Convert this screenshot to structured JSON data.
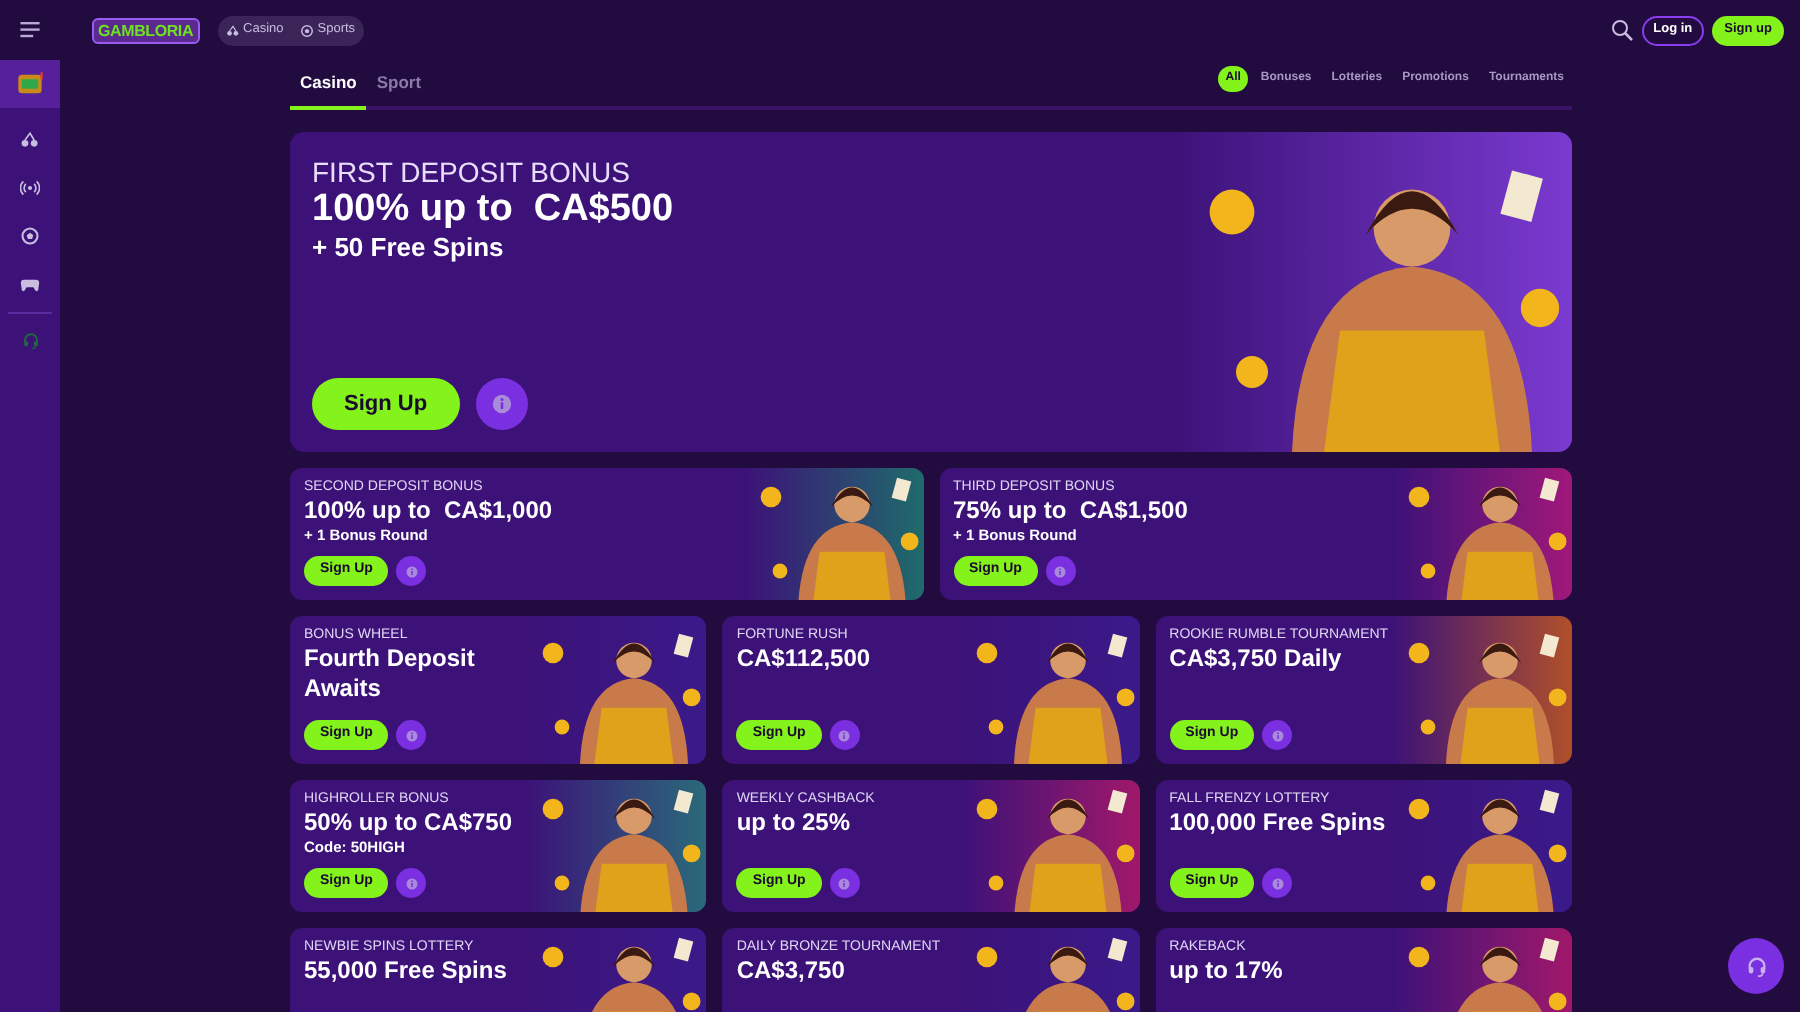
{
  "header": {
    "logo": "GAMBLORIA",
    "nav": [
      {
        "label": "Casino"
      },
      {
        "label": "Sports"
      }
    ],
    "login": "Log in",
    "signup": "Sign up"
  },
  "sidebar": {
    "items": [
      {
        "selected": true
      },
      {
        "selected": false
      },
      {
        "selected": false
      },
      {
        "selected": false
      },
      {
        "selected": false
      }
    ]
  },
  "tabs": [
    {
      "label": "Casino",
      "selected": true
    },
    {
      "label": "Sport",
      "selected": false
    }
  ],
  "filters": [
    {
      "label": "All",
      "selected": true
    },
    {
      "label": "Bonuses",
      "selected": false
    },
    {
      "label": "Lotteries",
      "selected": false
    },
    {
      "label": "Promotions",
      "selected": false
    },
    {
      "label": "Tournaments",
      "selected": false
    }
  ],
  "hero": {
    "label": "FIRST DEPOSIT BONUS",
    "title": "100% up to  CA$500",
    "subtitle": "+ 50 Free Spins",
    "button": "Sign Up",
    "kind": "picture"
  },
  "rows": [
    {
      "cards": [
        {
          "category": "SECOND DEPOSIT BONUS",
          "title": "100% up to  CA$1,000",
          "subtitle": "+ 1 Bonus Round",
          "button": "Sign Up"
        },
        {
          "category": "THIRD DEPOSIT BONUS",
          "title": "75% up to  CA$1,500",
          "subtitle": "+ 1 Bonus Round",
          "button": "Sign Up"
        }
      ]
    },
    {
      "cards": [
        {
          "category": "BONUS WHEEL",
          "title": "Fourth Deposit Awaits",
          "button": "Sign Up"
        },
        {
          "category": "FORTUNE RUSH",
          "title": "CA$112,500",
          "button": "Sign Up"
        },
        {
          "category": "ROOKIE RUMBLE TOURNAMENT",
          "title": "CA$3,750 Daily",
          "button": "Sign Up"
        }
      ]
    },
    {
      "cards": [
        {
          "category": "HIGHROLLER BONUS",
          "title": "50% up to CA$750",
          "subtitle": "Code: 50HIGH",
          "button": "Sign Up"
        },
        {
          "category": "WEEKLY CASHBACK",
          "title": "up to 25%",
          "button": "Sign Up"
        },
        {
          "category": "FALL FRENZY LOTTERY",
          "title": "100,000 Free Spins",
          "button": "Sign Up"
        }
      ]
    },
    {
      "cards": [
        {
          "category": "NEWBIE SPINS LOTTERY",
          "title": "55,000 Free Spins"
        },
        {
          "category": "DAILY BRONZE TOURNAMENT",
          "title": "CA$3,750"
        },
        {
          "category": "RAKEBACK",
          "title": "up to 17%"
        }
      ]
    }
  ]
}
